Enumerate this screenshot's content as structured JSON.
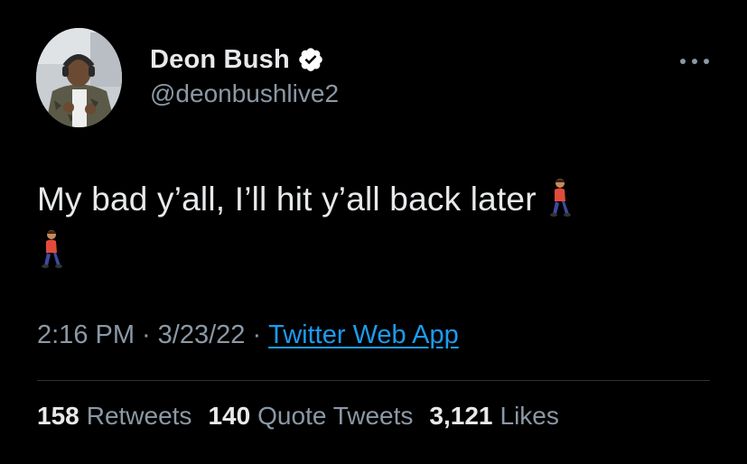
{
  "author": {
    "display_name": "Deon Bush",
    "handle": "@deonbushlive2",
    "verified": true
  },
  "tweet": {
    "text": "My bad y’all, I’ll hit y’all back later",
    "emojis": [
      "person-walking",
      "person-walking"
    ]
  },
  "meta": {
    "time": "2:16 PM",
    "separator": "·",
    "date": "3/23/22",
    "source": "Twitter Web App"
  },
  "stats": {
    "retweets_count": "158",
    "retweets_label": "Retweets",
    "quotes_count": "140",
    "quotes_label": "Quote Tweets",
    "likes_count": "3,121",
    "likes_label": "Likes"
  },
  "colors": {
    "background": "#000000",
    "primary_text": "#e7e9ea",
    "secondary_text": "#8b98a5",
    "link": "#1d9bf0",
    "verified_badge": "#ffffff"
  }
}
